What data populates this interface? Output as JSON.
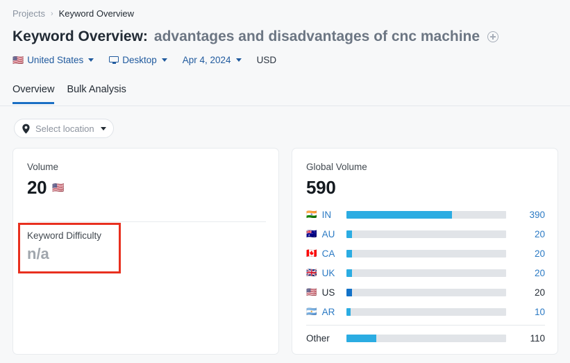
{
  "breadcrumb": {
    "root": "Projects",
    "separator": "›",
    "current": "Keyword Overview"
  },
  "header": {
    "title_prefix": "Keyword Overview:",
    "keyword": "advantages and disadvantages of cnc machine",
    "add_icon": "plus-circle-icon"
  },
  "meta": {
    "country": {
      "flag": "🇺🇸",
      "label": "United States",
      "icon": "chevron-down-icon"
    },
    "device": {
      "label": "Desktop",
      "icon": "monitor-icon"
    },
    "date": {
      "label": "Apr 4, 2024",
      "icon": "chevron-down-icon"
    },
    "currency": {
      "label": "USD"
    }
  },
  "tabs": [
    {
      "label": "Overview",
      "active": true
    },
    {
      "label": "Bulk Analysis",
      "active": false
    }
  ],
  "location_select": {
    "icon": "map-pin-icon",
    "placeholder": "Select location",
    "caret": "chevron-down-icon"
  },
  "volume_card": {
    "label": "Volume",
    "value": "20",
    "flag": "🇺🇸",
    "keyword_difficulty": {
      "label": "Keyword Difficulty",
      "value": "n/a",
      "highlight_color": "#e8301f"
    }
  },
  "global_volume_card": {
    "label": "Global Volume",
    "value": "590",
    "other": {
      "code": "Other",
      "value": "110"
    }
  },
  "chart_data": {
    "type": "bar",
    "title": "Global Volume",
    "total": 590,
    "orientation": "horizontal",
    "xlabel": "",
    "ylabel": "",
    "xlim": [
      0,
      590
    ],
    "grid": false,
    "legend": null,
    "categories": [
      "IN",
      "AU",
      "CA",
      "UK",
      "US",
      "AR",
      "Other"
    ],
    "values": [
      390,
      20,
      20,
      20,
      20,
      10,
      110
    ],
    "flags": [
      "🇮🇳",
      "🇦🇺",
      "🇨🇦",
      "🇬🇧",
      "🇺🇸",
      "🇦🇷",
      ""
    ],
    "current_index": 4,
    "colors": {
      "bar": "#2bace2",
      "bar_current": "#1272c8",
      "track": "#e1e4e8"
    }
  }
}
